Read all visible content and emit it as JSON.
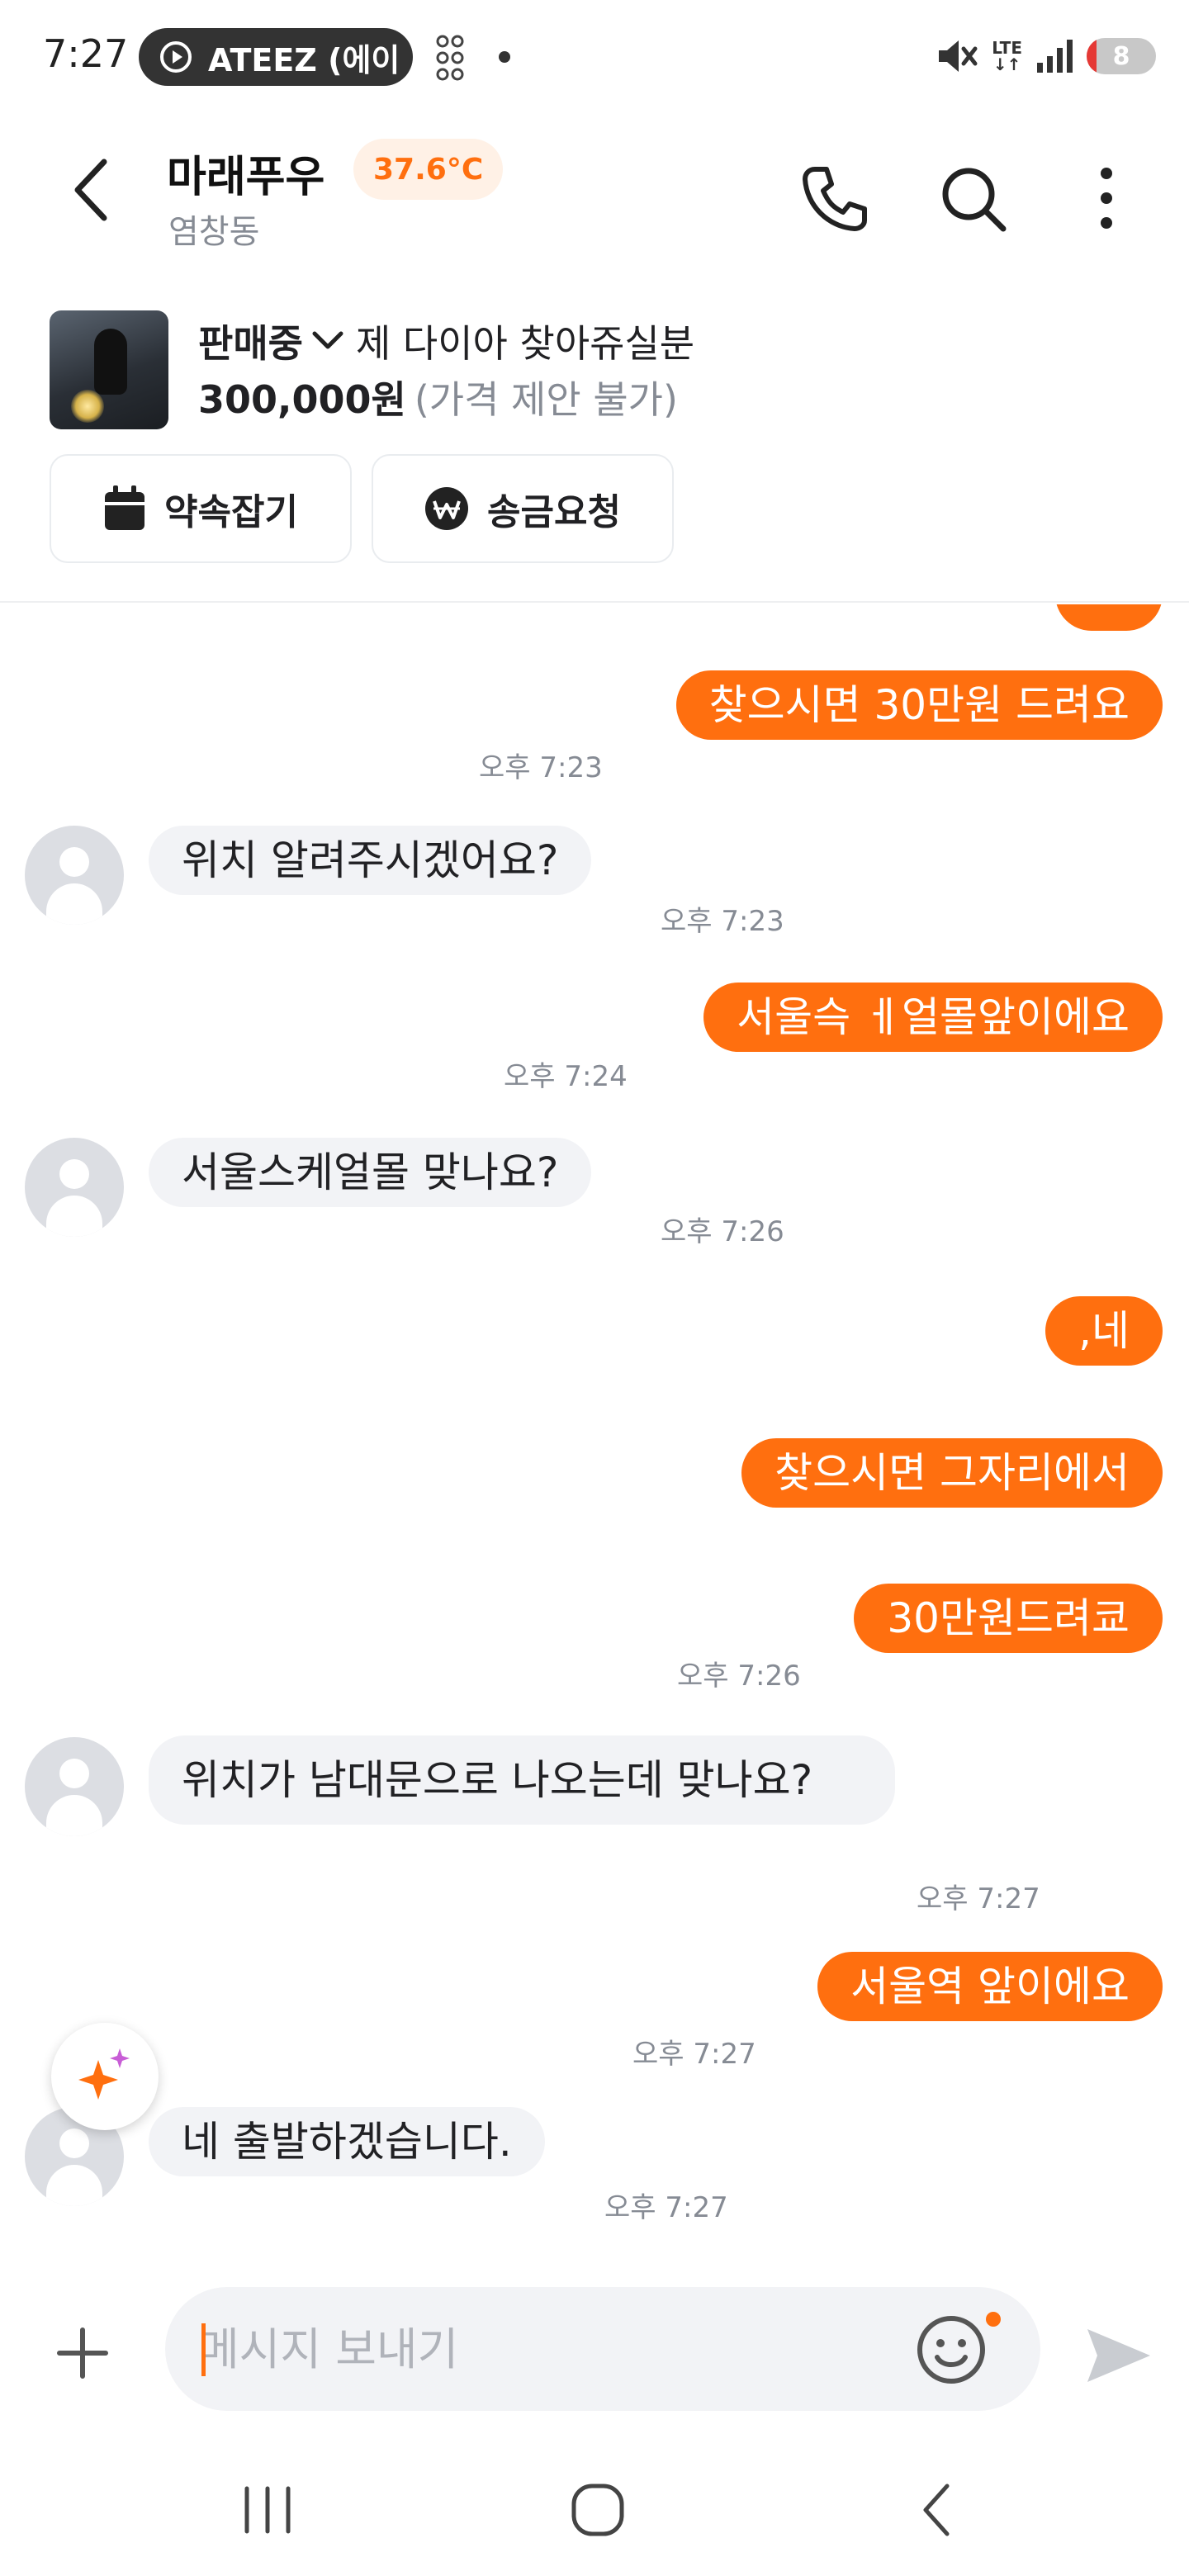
{
  "status_bar": {
    "time": "7:27",
    "media_title": "ATEEZ (에이",
    "network": "LTE",
    "battery": "8"
  },
  "header": {
    "name": "마래푸우",
    "temperature": "37.6°C",
    "location": "염창동"
  },
  "product": {
    "status": "판매중",
    "title": "제 다이아 찾아쥬실분",
    "price": "300,000원",
    "price_note": "(가격 제안 불가)",
    "actions": [
      {
        "label": "약속잡기",
        "icon": "calendar-icon"
      },
      {
        "label": "송금요청",
        "icon": "won-icon"
      }
    ]
  },
  "messages": [
    {
      "from": "me",
      "text": "찾으시면 30만원 드려요",
      "time": "오후 7:23"
    },
    {
      "from": "them",
      "text": "위치 알려주시겠어요?",
      "time": "오후 7:23"
    },
    {
      "from": "me",
      "text": "서울슥 ㅔ얼몰앞이에요",
      "time": "오후 7:24"
    },
    {
      "from": "them",
      "text": "서울스케얼몰 맞나요?",
      "time": "오후 7:26"
    },
    {
      "from": "me",
      "text": ",네",
      "time": ""
    },
    {
      "from": "me",
      "text": "찾으시면 그자리에서",
      "time": ""
    },
    {
      "from": "me",
      "text": "30만원드려쿄",
      "time": "오후 7:26"
    },
    {
      "from": "them",
      "text": "위치가 남대문으로 나오는데 맞나요?",
      "time": "오후 7:27"
    },
    {
      "from": "me",
      "text": "서울역 앞이에요",
      "time": "오후 7:27"
    },
    {
      "from": "them",
      "text": "네 출발하겠습니다.",
      "time": "오후 7:27"
    }
  ],
  "input": {
    "placeholder": "메시지 보내기",
    "value": ""
  },
  "colors": {
    "accent": "#ff6f0f",
    "bubble_other": "#f2f3f6",
    "muted_text": "#868b94"
  }
}
